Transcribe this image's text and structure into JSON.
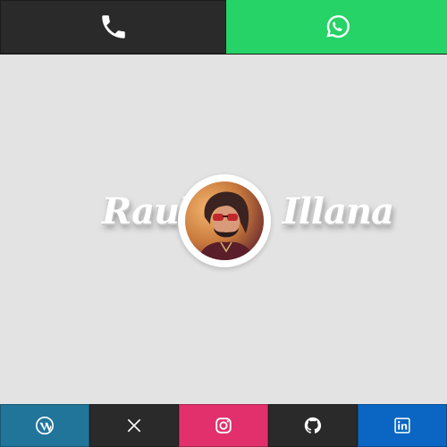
{
  "profile": {
    "first_name": "Raul",
    "last_name": "Illana"
  },
  "contact": [
    {
      "icon": "phone-icon",
      "color": "#2a2a2a"
    },
    {
      "icon": "whatsapp-icon",
      "color": "#25d366"
    }
  ],
  "social": [
    {
      "icon": "wordpress-icon",
      "color": "#21759b"
    },
    {
      "icon": "x-icon",
      "color": "#2a2a2a"
    },
    {
      "icon": "instagram-icon",
      "color": "#e1306c"
    },
    {
      "icon": "github-icon",
      "color": "#2a2a2a"
    },
    {
      "icon": "linkedin-icon",
      "color": "#0a66c2"
    }
  ],
  "colors": {
    "background": "#e3e3e3",
    "name_text": "#ffffff"
  }
}
